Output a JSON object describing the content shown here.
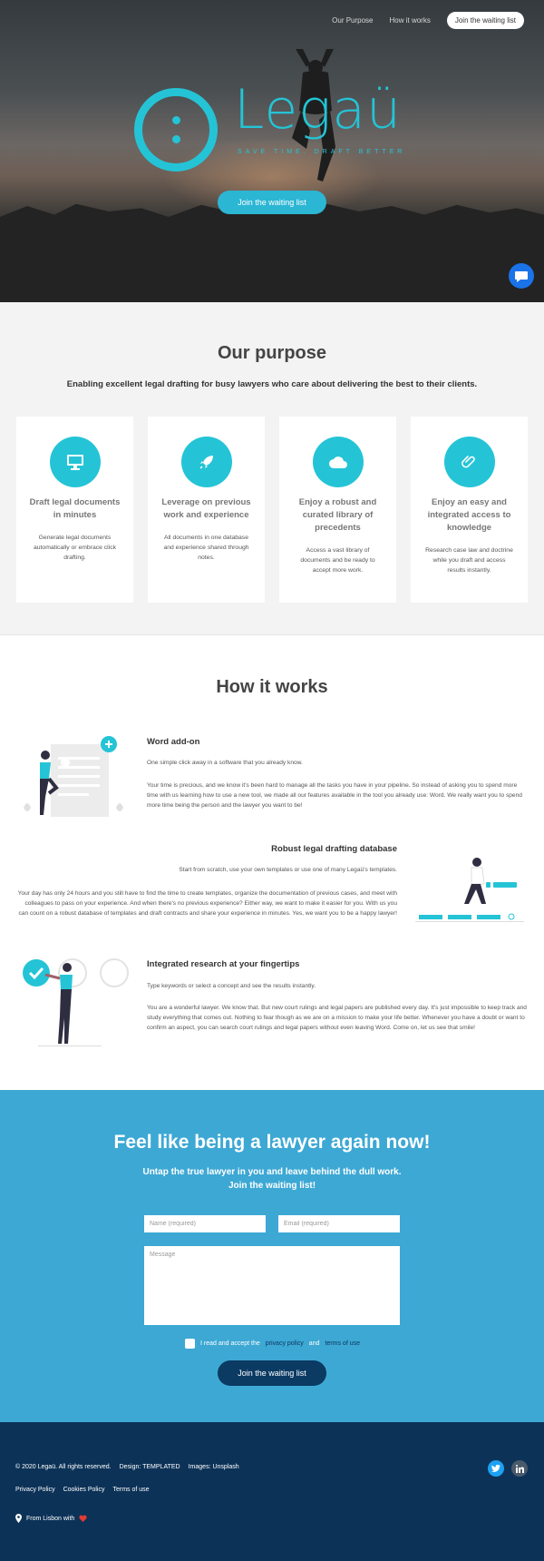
{
  "nav": {
    "purpose": "Our Purpose",
    "how": "How it works",
    "cta": "Join the waiting list"
  },
  "hero": {
    "logo_text": "Legaü",
    "tagline": "SAVE TIME. DRAFT BETTER",
    "cta": "Join the waiting list",
    "chat_icon": "chat-bubble-icon"
  },
  "purpose": {
    "title": "Our purpose",
    "subtitle": "Enabling excellent legal drafting for busy lawyers who care about delivering the best to their clients.",
    "cards": [
      {
        "icon": "monitor-icon",
        "title": "Draft legal documents in minutes",
        "text": "Generate legal documents automatically or embrace click drafting."
      },
      {
        "icon": "rocket-icon",
        "title": "Leverage on previous work and experience",
        "text": "All documents in one database and experience shared through notes."
      },
      {
        "icon": "cloud-icon",
        "title": "Enjoy a robust and curated library of precedents",
        "text": "Access a vast library of documents and be ready to accept more work."
      },
      {
        "icon": "paperclip-icon",
        "title": "Enjoy an easy and integrated access to knowledge",
        "text": "Research case law and doctrine while you draft and access results instantly."
      }
    ]
  },
  "how": {
    "title": "How it works",
    "features": [
      {
        "title": "Word add-on",
        "lead": "One simple click away in a software that you already know.",
        "body": "Your time is precious, and we know it's been hard to manage all the tasks you have in your pipeline. So instead of asking you to spend more time with us learning how to use a new tool, we made all our features available in the tool you already use: Word. We really want you to spend more time being the person and the lawyer you want to be!"
      },
      {
        "title": "Robust legal drafting database",
        "lead": "Start from scratch, use your own templates or use one of many Legaü's templates.",
        "body": "Your day has only 24 hours and you still have to find the time to create templates, organize the documentation of previous cases, and meet with colleagues to pass on your experience. And when there's no previous experience? Either way, we want to make it easier for you. With us you can count on a robust database of templates and draft contracts and share your experience in minutes. Yes, we want you to be a happy lawyer!"
      },
      {
        "title": "Integrated research at your fingertips",
        "lead": "Type keywords or select a concept and see the results instantly.",
        "body": "You are a wonderful lawyer. We know that. But new court rulings and legal papers are published every day. It's just impossible to keep track and study everything that comes out. Nothing to fear though as we are on a mission to make your life better. Whenever you have a doubt or want to confirm an aspect, you can search court rulings and legal papers without even leaving Word. Come on, let us see that smile!"
      }
    ]
  },
  "contact": {
    "title": "Feel like being a lawyer again now!",
    "sub1": "Untap the true lawyer in you and leave behind the dull work.",
    "sub2": "Join the waiting list!",
    "name_placeholder": "Name (required)",
    "email_placeholder": "Email (required)",
    "message_placeholder": "Message",
    "consent_prefix": "I read and accept the",
    "privacy": "privacy policy",
    "and": "and",
    "terms": "terms of use",
    "submit": "Join the waiting list"
  },
  "footer": {
    "copyright": "© 2020 Legaü. All rights reserved.",
    "design": "Design: TEMPLATED",
    "images": "Images: Unsplash",
    "links": [
      "Privacy Policy",
      "Cookies Policy",
      "Terms of use"
    ],
    "origin": "From Lisbon with",
    "heart_icon": "heart-icon",
    "social": [
      "twitter-icon",
      "linkedin-icon"
    ]
  },
  "colors": {
    "accent": "#24c4d6",
    "contact_bg": "#3da8d4",
    "footer_bg": "#0c3257",
    "button_dark": "#0b3a63"
  }
}
